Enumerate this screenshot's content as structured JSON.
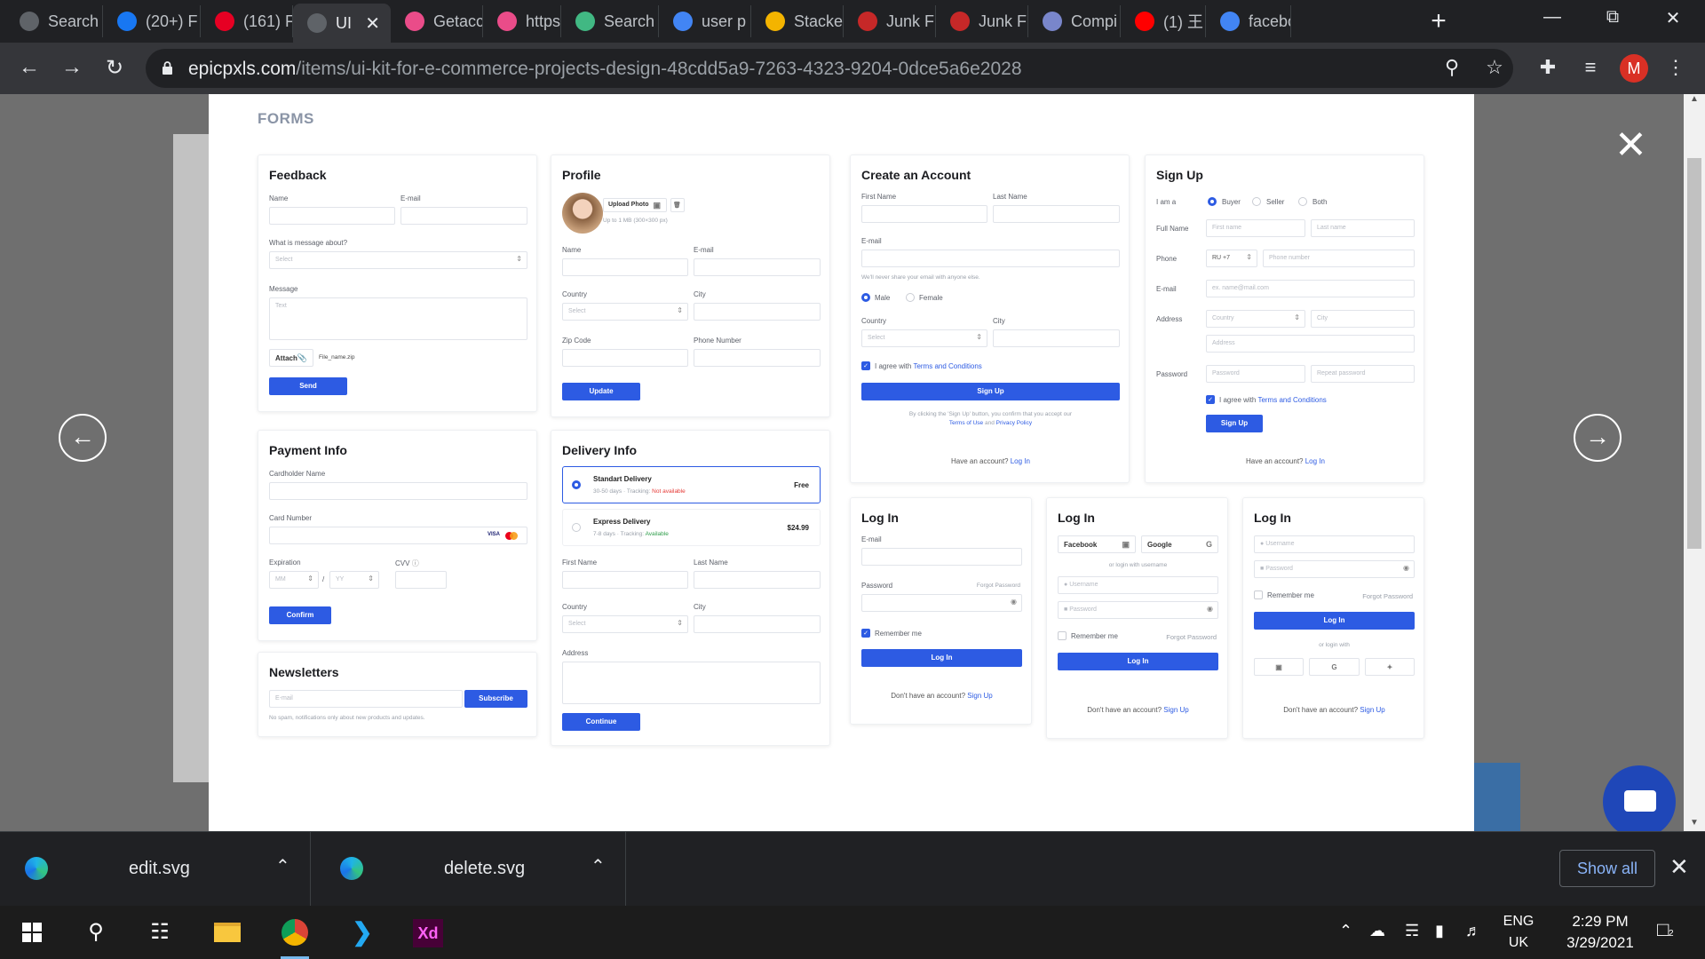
{
  "browser": {
    "tabs": [
      {
        "label": "Search",
        "favicon": "globe-icon",
        "color": "#5f6368"
      },
      {
        "label": "(20+) F",
        "favicon": "facebook-icon",
        "color": "#1877f2"
      },
      {
        "label": "(161) F",
        "favicon": "pinterest-icon",
        "color": "#e60023"
      },
      {
        "label": "UI",
        "favicon": "epicpxls-icon",
        "color": "#5f6368",
        "active": true
      },
      {
        "label": "Getacc",
        "favicon": "dribbble-icon",
        "color": "#ea4c89"
      },
      {
        "label": "https:/",
        "favicon": "dribbble-icon",
        "color": "#ea4c89"
      },
      {
        "label": "Search",
        "favicon": "vue-icon",
        "color": "#41b883"
      },
      {
        "label": "user p",
        "favicon": "google-icon",
        "color": "#4285f4"
      },
      {
        "label": "Stacke",
        "favicon": "stackexchange-icon",
        "color": "#f4b400"
      },
      {
        "label": "Junk F",
        "favicon": "junk-icon",
        "color": "#c62828"
      },
      {
        "label": "Junk F",
        "favicon": "junk-icon",
        "color": "#c62828"
      },
      {
        "label": "Compi",
        "favicon": "compiler-icon",
        "color": "#7986cb"
      },
      {
        "label": "(1) 王",
        "favicon": "youtube-icon",
        "color": "#ff0000"
      },
      {
        "label": "facebo",
        "favicon": "google-icon",
        "color": "#4285f4"
      }
    ],
    "new_tab": "+",
    "url_domain": "epicpxls.com",
    "url_path": "/items/ui-kit-for-e-commerce-projects-design-48cdd5a9-7263-4323-9204-0dce5a6e2028",
    "profile_initial": "M"
  },
  "page": {
    "section_title": "FORMS",
    "feedback": {
      "title": "Feedback",
      "name_label": "Name",
      "email_label": "E-mail",
      "about_label": "What is message about?",
      "about_placeholder": "Select",
      "message_label": "Message",
      "message_placeholder": "Text",
      "attach_label": "Attach",
      "file_name": "File_name.zip",
      "send": "Send"
    },
    "profile": {
      "title": "Profile",
      "upload": "Upload Photo",
      "hint": "Up to 1 MB (300×300 px)",
      "name_label": "Name",
      "email_label": "E-mail",
      "country_label": "Country",
      "country_placeholder": "Select",
      "city_label": "City",
      "zip_label": "Zip Code",
      "phone_label": "Phone Number",
      "update": "Update"
    },
    "create_account": {
      "title": "Create an Account",
      "first_label": "First Name",
      "last_label": "Last Name",
      "email_label": "E-mail",
      "email_hint": "We'll never share your email with anyone else.",
      "male": "Male",
      "female": "Female",
      "country_label": "Country",
      "country_placeholder": "Select",
      "city_label": "City",
      "agree": "I agree with",
      "terms": "Terms and Conditions",
      "signup": "Sign Up",
      "disclaimer": "By clicking the 'Sign Up' button, you confirm that you accept our",
      "terms_of_use": "Terms of Use",
      "and": "and",
      "privacy": "Privacy Policy",
      "have_account": "Have an account?",
      "login": "Log In"
    },
    "sign_up": {
      "title": "Sign Up",
      "i_am": "I am a",
      "buyer": "Buyer",
      "seller": "Seller",
      "both": "Both",
      "fullname_label": "Full Name",
      "first_ph": "First name",
      "last_ph": "Last name",
      "phone_label": "Phone",
      "phone_code": "RU +7",
      "phone_ph": "Phone number",
      "email_label": "E-mail",
      "email_ph": "ex. name@mail.com",
      "address_label": "Address",
      "country_ph": "Country",
      "city_ph": "City",
      "address_ph": "Address",
      "password_label": "Password",
      "password_ph": "Password",
      "repeat_ph": "Repeat password",
      "agree": "I agree with",
      "terms": "Terms and Conditions",
      "signup": "Sign Up",
      "have_account": "Have an account?",
      "login": "Log In"
    },
    "payment": {
      "title": "Payment Info",
      "holder_label": "Cardholder Name",
      "card_label": "Card Number",
      "visa": "VISA",
      "expiration_label": "Expiration",
      "mm": "MM",
      "slash": "/",
      "yy": "YY",
      "cvv_label": "CVV",
      "confirm": "Confirm"
    },
    "delivery": {
      "title": "Delivery Info",
      "options": [
        {
          "name": "Standart Delivery",
          "days": "30-50 days",
          "tracking": "Tracking:",
          "status": "Not available",
          "price": "Free",
          "selected": true
        },
        {
          "name": "Express Delivery",
          "days": "7-8 days",
          "tracking": "Tracking:",
          "status": "Available",
          "price": "$24.99",
          "selected": false
        }
      ],
      "first_label": "First Name",
      "last_label": "Last Name",
      "country_label": "Country",
      "country_placeholder": "Select",
      "city_label": "City",
      "address_label": "Address",
      "continue": "Continue"
    },
    "newsletters": {
      "title": "Newsletters",
      "email_ph": "E-mail",
      "subscribe": "Subscribe",
      "note": "No spam, notifications only about new products and updates."
    },
    "login1": {
      "title": "Log In",
      "email_label": "E-mail",
      "password_label": "Password",
      "forgot": "Forgot Password",
      "remember": "Remember me",
      "login": "Log In",
      "no_account": "Don't have an account?",
      "signup": "Sign Up"
    },
    "login2": {
      "title": "Log In",
      "facebook": "Facebook",
      "google": "Google",
      "or_username": "or login with username",
      "username_ph": "Username",
      "password_ph": "Password",
      "remember": "Remember me",
      "forgot": "Forgot Password",
      "login": "Log In",
      "no_account": "Don't have an account?",
      "signup": "Sign Up"
    },
    "login3": {
      "title": "Log In",
      "username_ph": "Username",
      "password_ph": "Password",
      "remember": "Remember me",
      "forgot": "Forgot Password",
      "login": "Log In",
      "or_with": "or login with",
      "no_account": "Don't have an account?",
      "signup": "Sign Up"
    }
  },
  "downloads": {
    "items": [
      {
        "name": "edit.svg"
      },
      {
        "name": "delete.svg"
      }
    ],
    "show_all": "Show all"
  },
  "taskbar": {
    "lang_line1": "ENG",
    "lang_line2": "UK",
    "time": "2:29 PM",
    "date": "3/29/2021",
    "notifications": "2"
  },
  "colors": {
    "accent": "#2d5be3",
    "not_available": "#e53935",
    "available": "#2e9d4a"
  }
}
